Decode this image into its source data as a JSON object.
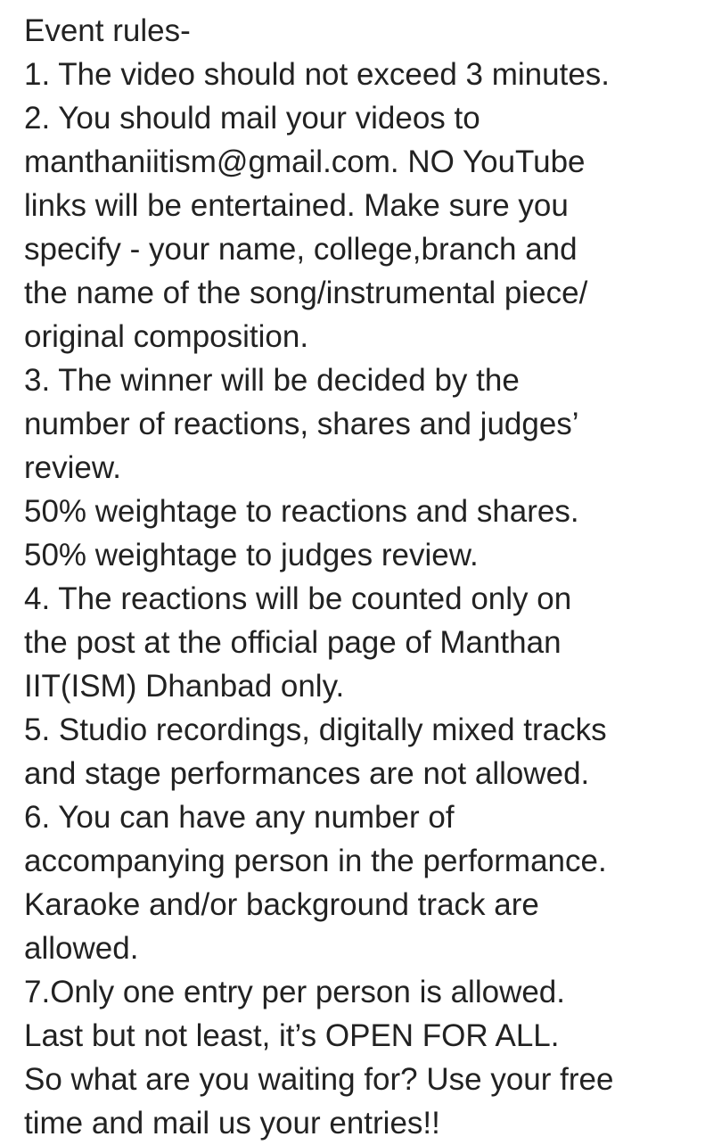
{
  "lines": [
    "Event rules-",
    "1. The video should not exceed 3 minutes.",
    "2. You should mail your videos to",
    "manthaniitism@gmail.com. NO YouTube",
    "links will be entertained. Make sure you",
    "specify - your name, college,branch and",
    "the name of the song/instrumental piece/",
    "original composition.",
    "3. The winner will be decided by the",
    "number of reactions, shares and judges’",
    "review.",
    "50% weightage to reactions and shares.",
    "50% weightage to judges review.",
    "4. The reactions will be counted only on",
    "the post at the official page of Manthan",
    "IIT(ISM) Dhanbad only.",
    "5. Studio recordings, digitally mixed tracks",
    "and stage performances are not allowed.",
    "6. You can have any number of",
    "accompanying person in the performance.",
    "Karaoke and/or background track are",
    "allowed.",
    "7.Only one entry per person is allowed.",
    "Last but not least, it’s OPEN FOR ALL.",
    "So what are you waiting for?  Use your free",
    "time and mail us your entries!!"
  ]
}
